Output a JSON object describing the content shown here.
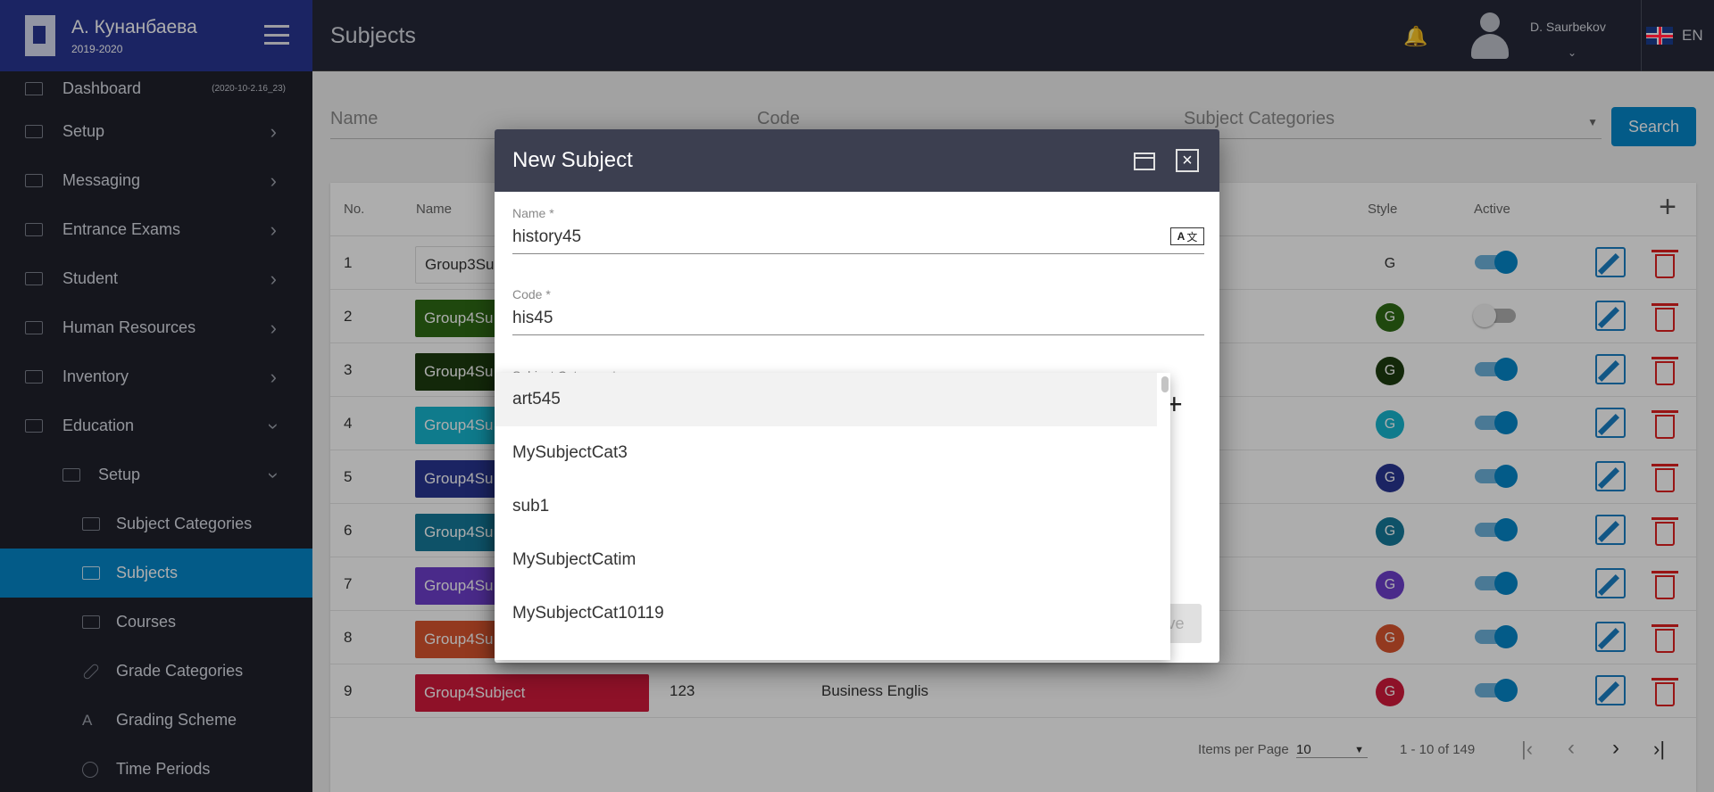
{
  "brand": {
    "name": "А. Кунанбаева",
    "year": "2019-2020"
  },
  "header": {
    "title": "Subjects",
    "user_name": "D. Saurbekov",
    "language": "EN"
  },
  "sidebar": {
    "version": "(2020-10-2.16_23)",
    "items": [
      {
        "label": "Dashboard"
      },
      {
        "label": "Setup"
      },
      {
        "label": "Messaging"
      },
      {
        "label": "Entrance Exams"
      },
      {
        "label": "Student"
      },
      {
        "label": "Human Resources"
      },
      {
        "label": "Inventory"
      },
      {
        "label": "Education"
      },
      {
        "label": "Setup"
      },
      {
        "label": "Subject Categories"
      },
      {
        "label": "Subjects"
      },
      {
        "label": "Courses"
      },
      {
        "label": "Grade Categories"
      },
      {
        "label": "Grading Scheme"
      },
      {
        "label": "Time Periods"
      }
    ]
  },
  "filters": {
    "name": "Name",
    "code": "Code",
    "category": "Subject Categories",
    "search": "Search"
  },
  "table": {
    "columns": {
      "no": "No.",
      "name": "Name",
      "style": "Style",
      "active": "Active"
    },
    "rows": [
      {
        "no": "1",
        "name": "Group3Su",
        "code": "",
        "category": "",
        "style": "G",
        "active": true,
        "color": "#ffffff",
        "style_color": "#ffffff"
      },
      {
        "no": "2",
        "name": "Group4Su",
        "code": "",
        "category": "",
        "style": "G",
        "active": false,
        "color": "#2e6b16",
        "style_color": "#2e6b16"
      },
      {
        "no": "3",
        "name": "Group4Su",
        "code": "",
        "category": "",
        "style": "G",
        "active": true,
        "color": "#1d3b10",
        "style_color": "#1d3b10"
      },
      {
        "no": "4",
        "name": "Group4Su",
        "code": "",
        "category": "",
        "style": "G",
        "active": true,
        "color": "#17b6cf",
        "style_color": "#17b6cf"
      },
      {
        "no": "5",
        "name": "Group4Su",
        "code": "",
        "category": "",
        "style": "G",
        "active": true,
        "color": "#283593",
        "style_color": "#283593"
      },
      {
        "no": "6",
        "name": "Group4Su",
        "code": "",
        "category": "",
        "style": "G",
        "active": true,
        "color": "#157a9a",
        "style_color": "#157a9a"
      },
      {
        "no": "7",
        "name": "Group4Su",
        "code": "",
        "category": "",
        "style": "G",
        "active": true,
        "color": "#6d3fcc",
        "style_color": "#6d3fcc"
      },
      {
        "no": "8",
        "name": "Group4Su",
        "code": "",
        "category": "",
        "style": "G",
        "active": true,
        "color": "#d9552e",
        "style_color": "#d9552e"
      },
      {
        "no": "9",
        "name": "Group4Subject",
        "code": "123",
        "category": "Business Englis",
        "style": "G",
        "active": true,
        "color": "#d11a3c",
        "style_color": "#d11a3c"
      }
    ]
  },
  "pagination": {
    "items_per_page_label": "Items per Page",
    "items_per_page": "10",
    "range": "1 - 10 of 149"
  },
  "modal": {
    "title": "New Subject",
    "name_label": "Name *",
    "name_value": "history45",
    "code_label": "Code *",
    "code_value": "his45",
    "category_label": "Subject Category *",
    "save_label": "Save",
    "translate_left": "A",
    "translate_right": "文",
    "options": [
      "art545",
      "MySubjectCat3",
      "sub1",
      "MySubjectCatim",
      "MySubjectCat10119"
    ]
  }
}
